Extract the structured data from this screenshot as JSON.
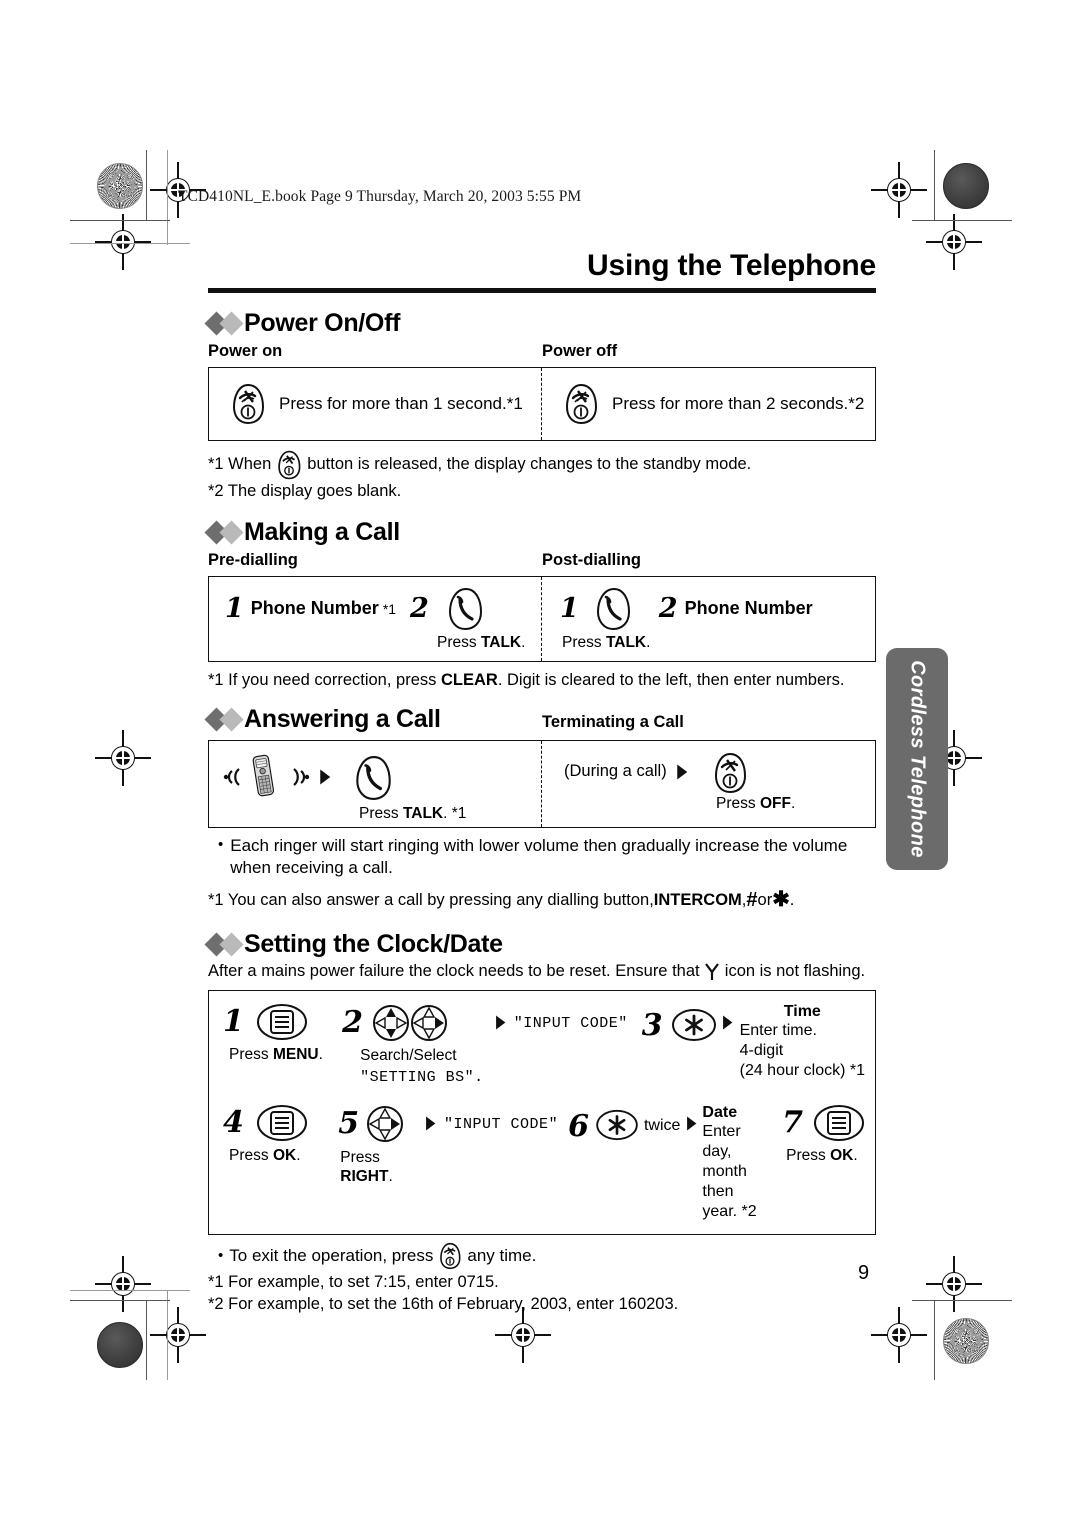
{
  "print_header": "TCD410NL_E.book  Page 9  Thursday, March 20, 2003  5:55 PM",
  "chapter_title": "Using the Telephone",
  "page_number": "9",
  "side_tab": "Cordless Telephone",
  "sections": {
    "power": {
      "title": "Power On/Off",
      "col_left_label": "Power on",
      "col_right_label": "Power off",
      "left_text": "Press for more than 1 second.*1",
      "right_text": "Press for more than 2 seconds.*2",
      "note1_a": "*1 When",
      "note1_b": "button is released, the display changes to the standby mode.",
      "note2": "*2 The display goes blank."
    },
    "making_call": {
      "title": "Making a Call",
      "col_left_label": "Pre-dialling",
      "col_right_label": "Post-dialling",
      "pre_step1_num": "1",
      "pre_step1_text": "Phone Number",
      "pre_step1_ref": "*1",
      "pre_step2_num": "2",
      "pre_step2_caption_pre": "Press ",
      "pre_step2_caption_key": "TALK",
      "pre_step2_caption_post": ".",
      "post_step1_num": "1",
      "post_step1_caption_pre": "Press ",
      "post_step1_caption_key": "TALK",
      "post_step1_caption_post": ".",
      "post_step2_num": "2",
      "post_step2_text": "Phone Number",
      "note": "*1 If you need correction, press CLEAR. Digit is cleared to the left, then enter numbers.",
      "note_pre": "*1 If you need correction, press ",
      "note_key": "CLEAR",
      "note_post": ". Digit is cleared to the left, then enter numbers."
    },
    "answering": {
      "title": "Answering a Call",
      "right_label": "Terminating a Call",
      "left_caption_pre": "Press ",
      "left_caption_key": "TALK",
      "left_caption_post": ". *1",
      "right_prefix": "(During a call)",
      "right_caption_pre": "Press ",
      "right_caption_key": "OFF",
      "right_caption_post": ".",
      "bullet": "Each ringer will start ringing with lower volume then gradually increase the volume when receiving a call.",
      "note_pre": "*1 You can also answer a call by pressing any dialling button, ",
      "note_key": "INTERCOM",
      "note_mid": ", ",
      "note_hash": "#",
      "note_or": " or ",
      "note_star": "✱",
      "note_end": "."
    },
    "clock": {
      "title": "Setting the Clock/Date",
      "intro_a": "After a mains power failure the clock needs to be reset. Ensure that",
      "intro_b": "icon is not flashing.",
      "steps": [
        {
          "num": "1",
          "icon": "menu-icon",
          "caption_pre": "Press ",
          "caption_key": "MENU",
          "caption_post": "."
        },
        {
          "num": "2",
          "icon": "nav-updown-icon + nav-right-icon",
          "caption_line1": "Search/Select",
          "caption_mono": "\"SETTING BS\".",
          "display": "\"INPUT CODE\""
        },
        {
          "num": "3",
          "icon": "star-key-icon",
          "header": "Time",
          "line1": "Enter time.",
          "line2": "4-digit",
          "line3": "(24 hour clock) *1"
        },
        {
          "num": "4",
          "icon": "menu-icon",
          "caption_pre": "Press ",
          "caption_key": "OK",
          "caption_post": "."
        },
        {
          "num": "5",
          "icon": "nav-right-icon",
          "caption_pre": "Press",
          "caption_key": "RIGHT",
          "caption_post": ".",
          "display": "\"INPUT CODE\""
        },
        {
          "num": "6",
          "icon": "star-key-icon",
          "twice": "twice",
          "header": "Date",
          "line1": "Enter day,",
          "line2": "month then",
          "line3": "year. *2"
        },
        {
          "num": "7",
          "icon": "menu-icon",
          "caption_pre": "Press ",
          "caption_key": "OK",
          "caption_post": "."
        }
      ],
      "footnotes": {
        "bullet_a": "To exit the operation, press",
        "bullet_b": "any time.",
        "f1": "*1 For example, to set 7:15, enter 0715.",
        "f2": "*2 For example, to set the 16th of February, 2003, enter 160203."
      }
    }
  },
  "colors": {
    "ink": "#111111",
    "diamond_dark": "#6e6e6e",
    "diamond_light": "#b9b9b9",
    "tab_gray": "#6b6b6b"
  }
}
